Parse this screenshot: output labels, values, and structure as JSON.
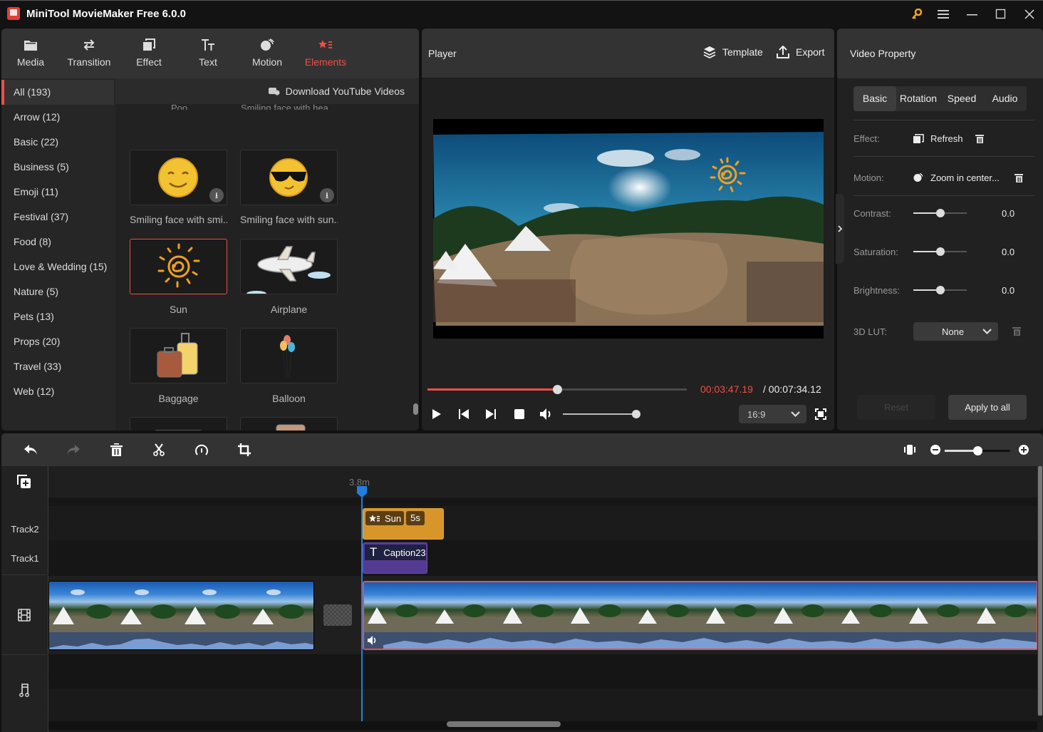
{
  "window": {
    "title": "MiniTool MovieMaker Free 6.0.0",
    "controls": [
      "key-icon",
      "menu-icon",
      "minimize-icon",
      "maximize-icon",
      "close-icon"
    ]
  },
  "toolbar": {
    "items": [
      {
        "label": "Media",
        "icon": "folder-icon"
      },
      {
        "label": "Transition",
        "icon": "swap-arrows-icon"
      },
      {
        "label": "Effect",
        "icon": "effect-squares-icon"
      },
      {
        "label": "Text",
        "icon": "text-tt-icon"
      },
      {
        "label": "Motion",
        "icon": "motion-balls-icon"
      },
      {
        "label": "Elements",
        "icon": "elements-star-icon",
        "active": true
      }
    ]
  },
  "categories": [
    {
      "label": "All (193)",
      "active": true
    },
    {
      "label": "Arrow (12)"
    },
    {
      "label": "Basic (22)"
    },
    {
      "label": "Business (5)"
    },
    {
      "label": "Emoji (11)"
    },
    {
      "label": "Festival (37)"
    },
    {
      "label": "Food (8)"
    },
    {
      "label": "Love & Wedding (15)"
    },
    {
      "label": "Nature (5)"
    },
    {
      "label": "Pets (13)"
    },
    {
      "label": "Props (20)"
    },
    {
      "label": "Travel (33)"
    },
    {
      "label": "Web (12)"
    }
  ],
  "library": {
    "download_link": "Download YouTube Videos",
    "cut_captions": [
      "Poo",
      "Smiling face with hea..."
    ],
    "elements": [
      {
        "name": "Smiling face with smi...",
        "icon": "smiling-face-icon",
        "download": true
      },
      {
        "name": "Smiling face with sun...",
        "icon": "sunglasses-face-icon",
        "download": true
      },
      {
        "name": "Sun",
        "icon": "sun-icon",
        "selected": true
      },
      {
        "name": "Airplane",
        "icon": "airplane-icon"
      },
      {
        "name": "Baggage",
        "icon": "baggage-icon"
      },
      {
        "name": "Balloon",
        "icon": "balloon-icon"
      },
      {
        "name": "",
        "icon": "bus-icon"
      },
      {
        "name": "",
        "icon": "camera-icon"
      }
    ]
  },
  "player": {
    "title": "Player",
    "template_label": "Template",
    "export_label": "Export",
    "current_time": "00:03:47.19",
    "total_time": "/ 00:07:34.12",
    "progress": 0.5,
    "volume": 1.0,
    "aspect_ratio": "16:9",
    "accent": "#f04e46"
  },
  "property": {
    "title": "Video Property",
    "tabs": [
      "Basic",
      "Rotation",
      "Speed",
      "Audio"
    ],
    "active_tab": "Basic",
    "effect_label": "Effect:",
    "effect_value": "Refresh",
    "motion_label": "Motion:",
    "motion_value": "Zoom in center...",
    "adjust": [
      {
        "label": "Contrast:",
        "value": "0.0",
        "level": 0.5
      },
      {
        "label": "Saturation:",
        "value": "0.0",
        "level": 0.5
      },
      {
        "label": "Brightness:",
        "value": "0.0",
        "level": 0.5
      }
    ],
    "lut_label": "3D LUT:",
    "lut_value": "None",
    "reset_label": "Reset",
    "apply_label": "Apply to all"
  },
  "timeline": {
    "playhead_label": "3.8m",
    "zoom_level": 0.5,
    "tracks": [
      "Track2",
      "Track1"
    ],
    "element_clip": {
      "label": "Sun",
      "duration": "5s",
      "color": "#d89529"
    },
    "text_clip": {
      "label": "Caption23",
      "color": "#553a92"
    }
  }
}
